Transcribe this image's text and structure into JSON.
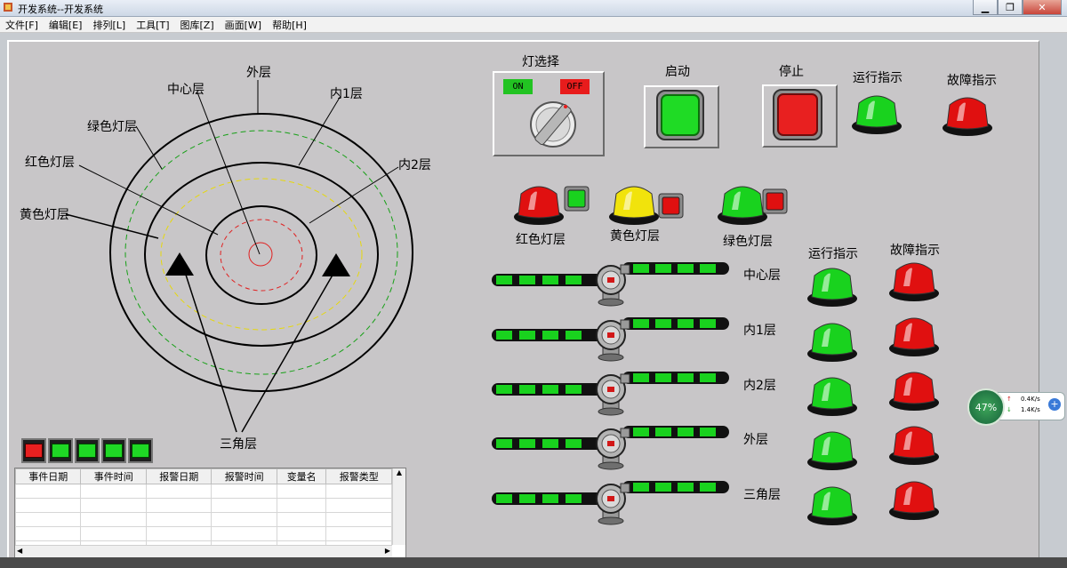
{
  "window": {
    "title": "开发系统--开发系统"
  },
  "menu": [
    "文件[F]",
    "编辑[E]",
    "排列[L]",
    "工具[T]",
    "图库[Z]",
    "画面[W]",
    "帮助[H]"
  ],
  "diagram": {
    "labels": {
      "outer": "外层",
      "center": "中心层",
      "inner1": "内1层",
      "green_layer": "绿色灯层",
      "red_layer": "红色灯层",
      "inner2": "内2层",
      "yellow_layer": "黄色灯层",
      "triangle": "三角层"
    }
  },
  "controls": {
    "lamp_select": "灯选择",
    "on": "ON",
    "off": "OFF",
    "start": "启动",
    "stop": "停止",
    "run_indicator": "运行指示",
    "fault_indicator": "故障指示"
  },
  "light_groups": [
    "红色灯层",
    "黄色灯层",
    "绿色灯层"
  ],
  "column_headers": {
    "run": "运行指示",
    "fault": "故障指示"
  },
  "pipelines": [
    "中心层",
    "内1层",
    "内2层",
    "外层",
    "三角层"
  ],
  "alarm_table": {
    "columns": [
      "事件日期",
      "事件时间",
      "报警日期",
      "报警时间",
      "变量名",
      "报警类型"
    ],
    "rows": 5,
    "status_lamps": [
      "red",
      "green",
      "green",
      "green",
      "green"
    ]
  },
  "network": {
    "percent": "47%",
    "upload": "0.4K/s",
    "download": "1.4K/s"
  },
  "colors": {
    "green": "#19d21e",
    "red": "#e01010",
    "yellow": "#f1e30c",
    "panel": "#c8c6c8"
  }
}
